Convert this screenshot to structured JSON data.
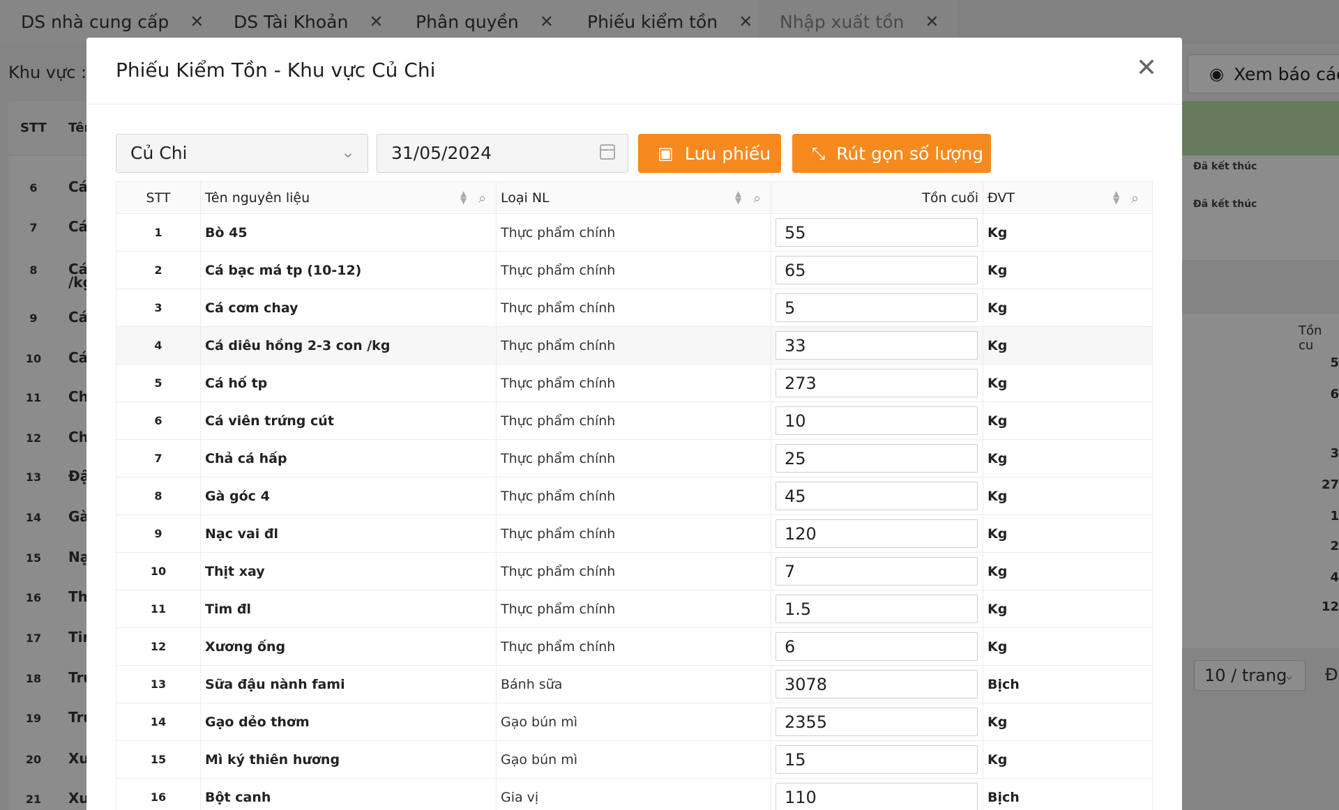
{
  "tabs": [
    {
      "label": "DS nhà cung cấp",
      "close": "✕"
    },
    {
      "label": "DS Tài Khoản",
      "close": "✕"
    },
    {
      "label": "Phân quyền",
      "close": "✕"
    },
    {
      "label": "Phiếu kiểm tồn",
      "close": "✕"
    },
    {
      "label": "Nhập xuất tồn",
      "close": "✕"
    }
  ],
  "background": {
    "khuvuc_label": "Khu vực :",
    "xem_bao_cao": "Xem báo cáo",
    "head_stt": "STT",
    "head_ten": "Tên",
    "rows": [
      {
        "n": "6",
        "t": "Cá"
      },
      {
        "n": "7",
        "t": "Cá"
      },
      {
        "n": "8",
        "t": "Cá"
      },
      {
        "n": "9",
        "t": "Cá"
      },
      {
        "n": "10",
        "t": "Cá"
      },
      {
        "n": "11",
        "t": "Ch"
      },
      {
        "n": "12",
        "t": "Ch"
      },
      {
        "n": "13",
        "t": "Đậ"
      },
      {
        "n": "14",
        "t": "Gà"
      },
      {
        "n": "15",
        "t": "Nạ"
      },
      {
        "n": "16",
        "t": "Th"
      },
      {
        "n": "17",
        "t": "Tir"
      },
      {
        "n": "18",
        "t": "Trứ"
      },
      {
        "n": "19",
        "t": "Trứ"
      },
      {
        "n": "20",
        "t": "Xư"
      },
      {
        "n": "21",
        "t": "Xư"
      }
    ],
    "row8_extra": "/kg",
    "status_1": "Đã kết thúc",
    "status_2": "Đã kết thúc",
    "ton_head": "Tồn cu",
    "ton_vals": [
      "5",
      "6",
      "3",
      "27",
      "1",
      "2",
      "4",
      "12"
    ],
    "pager": "10 / trang",
    "pager_next": "Đ"
  },
  "modal": {
    "title": "Phiếu Kiểm Tồn - Khu vực Củ Chi",
    "close": "✕",
    "area_select": "Củ Chi",
    "date": "31/05/2024",
    "save_button": "Lưu phiếu",
    "compact_button": "Rút gọn số lượng",
    "columns": {
      "stt": "STT",
      "name": "Tên nguyên liệu",
      "type": "Loại NL",
      "ton": "Tồn cuối",
      "dvt": "ĐVT"
    },
    "rows": [
      {
        "stt": "1",
        "name": "Bò 45",
        "type": "Thực phẩm chính",
        "ton": "55",
        "dvt": "Kg"
      },
      {
        "stt": "2",
        "name": "Cá bạc má tp (10-12)",
        "type": "Thực phẩm chính",
        "ton": "65",
        "dvt": "Kg"
      },
      {
        "stt": "3",
        "name": "Cá cơm chay",
        "type": "Thực phẩm chính",
        "ton": "5",
        "dvt": "Kg"
      },
      {
        "stt": "4",
        "name": "Cá diêu hồng 2-3 con /kg",
        "type": "Thực phẩm chính",
        "ton": "33",
        "dvt": "Kg"
      },
      {
        "stt": "5",
        "name": "Cá hố tp",
        "type": "Thực phẩm chính",
        "ton": "273",
        "dvt": "Kg"
      },
      {
        "stt": "6",
        "name": "Cá viên trứng cút",
        "type": "Thực phẩm chính",
        "ton": "10",
        "dvt": "Kg"
      },
      {
        "stt": "7",
        "name": "Chả cá hấp",
        "type": "Thực phẩm chính",
        "ton": "25",
        "dvt": "Kg"
      },
      {
        "stt": "8",
        "name": "Gà góc 4",
        "type": "Thực phẩm chính",
        "ton": "45",
        "dvt": "Kg"
      },
      {
        "stt": "9",
        "name": "Nạc vai đl",
        "type": "Thực phẩm chính",
        "ton": "120",
        "dvt": "Kg"
      },
      {
        "stt": "10",
        "name": "Thịt xay",
        "type": "Thực phẩm chính",
        "ton": "7",
        "dvt": "Kg"
      },
      {
        "stt": "11",
        "name": "Tim đl",
        "type": "Thực phẩm chính",
        "ton": "1.5",
        "dvt": "Kg"
      },
      {
        "stt": "12",
        "name": "Xương ống",
        "type": "Thực phẩm chính",
        "ton": "6",
        "dvt": "Kg"
      },
      {
        "stt": "13",
        "name": "Sữa đậu nành fami",
        "type": "Bánh sữa",
        "ton": "3078",
        "dvt": "Bịch"
      },
      {
        "stt": "14",
        "name": "Gạo dẻo thơm",
        "type": "Gạo bún mì",
        "ton": "2355",
        "dvt": "Kg"
      },
      {
        "stt": "15",
        "name": "Mì ký thiên hương",
        "type": "Gạo bún mì",
        "ton": "15",
        "dvt": "Kg"
      },
      {
        "stt": "16",
        "name": "Bột canh",
        "type": "Gia vị",
        "ton": "110",
        "dvt": "Bịch"
      }
    ]
  },
  "colors": {
    "accent": "#f68a1e",
    "status_green": "#b8e0a6"
  },
  "icons": [
    "close-icon",
    "chevron-down-icon",
    "calendar-icon",
    "save-icon",
    "compress-icon",
    "sort-icon",
    "search-icon",
    "eye-icon"
  ]
}
